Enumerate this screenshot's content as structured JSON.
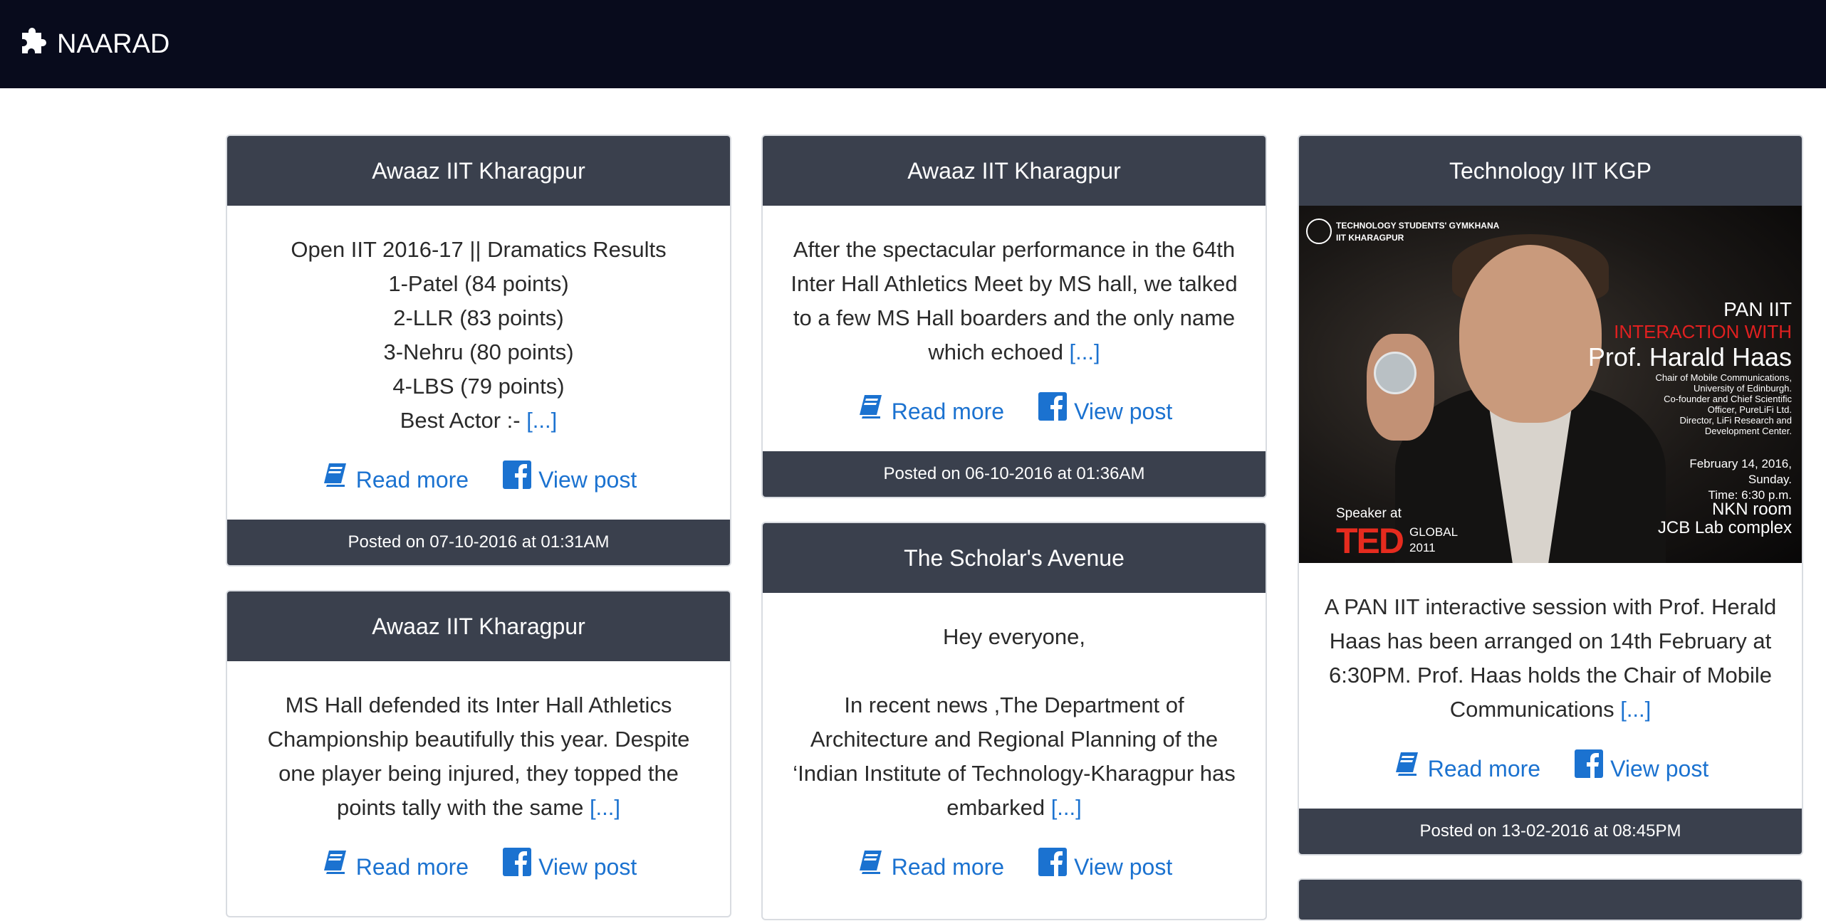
{
  "navbar": {
    "brand": "NAARAD",
    "brand_icon": "puzzle-piece-icon",
    "bg": "#080b1c"
  },
  "actions": {
    "read_more": "Read more",
    "view_post": "View post",
    "read_icon": "book-icon",
    "fb_icon": "facebook-icon"
  },
  "more_link": "[...]",
  "colors": {
    "header": "#3a404d",
    "link": "#1b72d0"
  },
  "cards": [
    {
      "title": "Awaaz IIT Kharagpur",
      "text": "Open IIT 2016-17 || Dramatics Results\n1-Patel (84 points)\n2-LLR (83 points)\n3-Nehru (80 points)\n4-LBS (79 points)\nBest Actor :- ",
      "footer": "Posted on 07-10-2016 at 01:31AM"
    },
    {
      "title": "Awaaz IIT Kharagpur",
      "text": "MS Hall defended its Inter Hall Athletics Championship beautifully this year. Despite one player being injured, they topped the points tally with the same "
    },
    {
      "title": "Awaaz IIT Kharagpur",
      "text": "After the spectacular performance in the 64th Inter Hall Athletics Meet by MS hall, we talked to a few MS Hall boarders and the only name which echoed ",
      "footer": "Posted on 06-10-2016 at 01:36AM"
    },
    {
      "title": "The Scholar's Avenue",
      "text": "Hey everyone,\n\nIn recent news ,The Department of Architecture and Regional Planning of the ‘Indian Institute of Technology-Kharagpur has embarked "
    },
    {
      "title": "Technology IIT KGP",
      "text": "A PAN IIT interactive session with Prof. Herald Haas has been arranged on 14th February at 6:30PM. Prof. Haas holds the Chair of Mobile Communications ",
      "footer": "Posted on 13-02-2016 at 08:45PM",
      "poster": {
        "org": "TECHNOLOGY STUDENTS' GYMKHANA\nIIT KHARAGPUR",
        "line1": "PAN IIT",
        "line2": "INTERACTION WITH",
        "line3": "Prof. Harald Haas",
        "bio": "Chair of Mobile Communications,\nUniversity of Edinburgh.\nCo-founder and Chief Scientific\nOfficer, PureLiFi Ltd.\nDirector, LiFi Research and\nDevelopment Center.",
        "when": "February 14, 2016,\nSunday.\nTime: 6:30 p.m.",
        "where": "NKN room\nJCB Lab complex",
        "speaker_at": "Speaker at",
        "ted": "TED",
        "ted_event": "GLOBAL\n2011"
      }
    }
  ]
}
